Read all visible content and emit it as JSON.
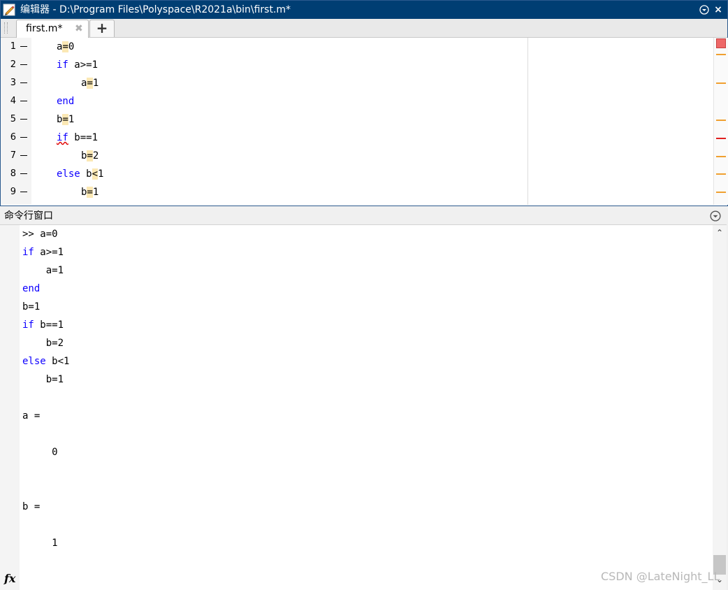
{
  "window": {
    "title": "编辑器 - D:\\Program Files\\Polyspace\\R2021a\\bin\\first.m*",
    "menu_icon": "chevron-down-circle-icon",
    "close_icon": "×"
  },
  "tabs": {
    "active_label": "first.m*",
    "close_symbol": "✖",
    "add_symbol": "+"
  },
  "editor": {
    "lines": [
      {
        "num": "1",
        "dash": "—"
      },
      {
        "num": "2",
        "dash": "—"
      },
      {
        "num": "3",
        "dash": "—"
      },
      {
        "num": "4",
        "dash": "—"
      },
      {
        "num": "5",
        "dash": "—"
      },
      {
        "num": "6",
        "dash": "—"
      },
      {
        "num": "7",
        "dash": "—"
      },
      {
        "num": "8",
        "dash": "—"
      },
      {
        "num": "9",
        "dash": "—"
      }
    ],
    "code": {
      "l1": {
        "pre": "a",
        "hl": "=",
        "post": "0"
      },
      "l2": {
        "kw": "if",
        "post": " a>=1"
      },
      "l3": {
        "pre": "a",
        "hl": "=",
        "post": "1"
      },
      "l4": {
        "kw": "end"
      },
      "l5": {
        "pre": "b",
        "hl": "=",
        "post": "1"
      },
      "l6": {
        "kw": "if",
        "post": " b==1"
      },
      "l7": {
        "pre": "b",
        "hl": "=",
        "post": "2"
      },
      "l8": {
        "kw": "else",
        "pre": " b",
        "hl": "<",
        "post": "1"
      },
      "l9": {
        "pre": "b",
        "hl": "=",
        "post": "1"
      }
    },
    "colors": {
      "keyword": "#0e00ff",
      "highlight": "#fbe8b4",
      "warning": "#f0a030",
      "error": "#e02020"
    }
  },
  "command_window": {
    "title": "命令行窗口",
    "lines": [
      {
        "kw": "",
        "text": ">> a=0"
      },
      {
        "kw": "if",
        "text": " a>=1"
      },
      {
        "kw": "",
        "text": "    a=1"
      },
      {
        "kw": "end",
        "text": ""
      },
      {
        "kw": "",
        "text": "b=1"
      },
      {
        "kw": "if",
        "text": " b==1"
      },
      {
        "kw": "",
        "text": "    b=2"
      },
      {
        "kw": "else",
        "text": " b<1"
      },
      {
        "kw": "",
        "text": "    b=1"
      },
      {
        "kw": "",
        "text": "a ="
      },
      {
        "kw": "",
        "text": "     0"
      },
      {
        "kw": "",
        "text": "b ="
      },
      {
        "kw": "",
        "text": "     1"
      }
    ],
    "fx_label": "fx",
    "scroll_up": "⌃",
    "scroll_down": "⌄"
  },
  "watermark": "CSDN @LateNight_LL"
}
